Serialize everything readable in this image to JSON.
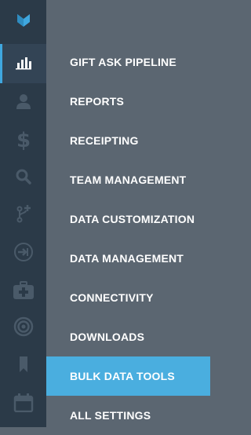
{
  "colors": {
    "rail_bg": "#2b3a48",
    "menu_bg": "#5b6671",
    "accent": "#3fa7df",
    "active_item_bg": "#4aaedf",
    "icon_color": "#4a5a69",
    "logo_color": "#3fa7df"
  },
  "rail": {
    "icons": [
      {
        "name": "logo-icon"
      },
      {
        "name": "bar-chart-icon",
        "active": true
      },
      {
        "name": "user-icon"
      },
      {
        "name": "dollar-icon"
      },
      {
        "name": "search-icon"
      },
      {
        "name": "branch-plus-icon"
      },
      {
        "name": "sign-in-icon"
      },
      {
        "name": "medical-kit-icon"
      },
      {
        "name": "target-icon"
      },
      {
        "name": "bookmark-icon"
      },
      {
        "name": "calendar-icon"
      }
    ]
  },
  "menu": {
    "items": [
      {
        "label": "GIFT ASK PIPELINE"
      },
      {
        "label": "REPORTS"
      },
      {
        "label": "RECEIPTING"
      },
      {
        "label": "TEAM MANAGEMENT"
      },
      {
        "label": "DATA CUSTOMIZATION"
      },
      {
        "label": "DATA MANAGEMENT"
      },
      {
        "label": "CONNECTIVITY"
      },
      {
        "label": "DOWNLOADS"
      },
      {
        "label": "BULK DATA TOOLS",
        "active": true
      },
      {
        "label": "ALL SETTINGS"
      }
    ]
  }
}
